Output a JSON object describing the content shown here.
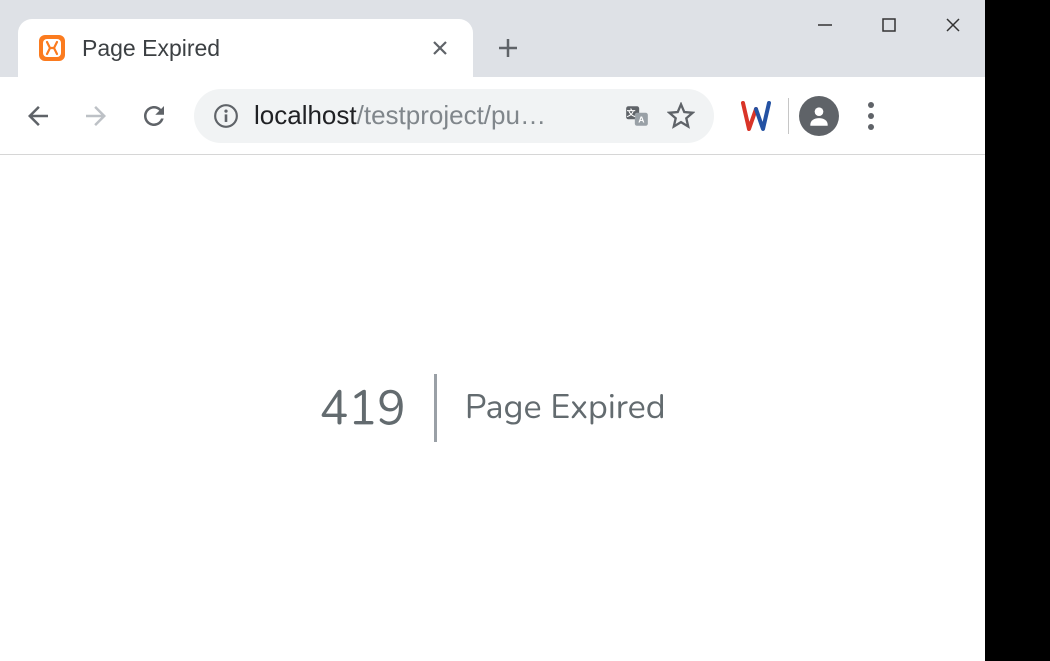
{
  "tab": {
    "title": "Page Expired"
  },
  "url": {
    "host": "localhost",
    "path": "/testproject/pu…"
  },
  "error": {
    "code": "419",
    "message": "Page Expired"
  }
}
